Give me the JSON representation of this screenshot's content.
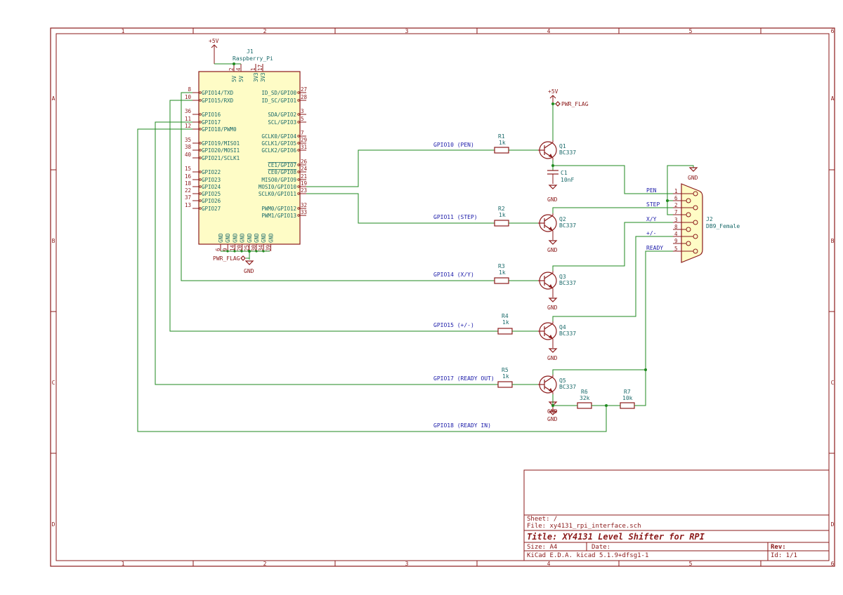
{
  "border": {
    "columns": [
      "1",
      "2",
      "3",
      "4",
      "5",
      "6"
    ],
    "rows": [
      "A",
      "B",
      "C",
      "D"
    ]
  },
  "power": {
    "vcc": "+5V",
    "gnd": "GND",
    "pwr_flag": "PWR_FLAG"
  },
  "rpi": {
    "ref": "J1",
    "value": "Raspberry_Pi",
    "left_pins": [
      {
        "num": "8",
        "name": "GPIO14/TXD"
      },
      {
        "num": "10",
        "name": "GPIO15/RXD"
      },
      {
        "num": "36",
        "name": "GPIO16"
      },
      {
        "num": "11",
        "name": "GPIO17"
      },
      {
        "num": "12",
        "name": "GPIO18/PWM0"
      },
      {
        "num": "35",
        "name": "GPIO19/MISO1"
      },
      {
        "num": "38",
        "name": "GPIO20/MOSI1"
      },
      {
        "num": "40",
        "name": "GPIO21/SCLK1"
      },
      {
        "num": "15",
        "name": "GPIO22"
      },
      {
        "num": "16",
        "name": "GPIO23"
      },
      {
        "num": "18",
        "name": "GPIO24"
      },
      {
        "num": "22",
        "name": "GPIO25"
      },
      {
        "num": "37",
        "name": "GPIO26"
      },
      {
        "num": "13",
        "name": "GPIO27"
      }
    ],
    "right_pins": [
      {
        "num": "27",
        "name": "ID_SD/GPIO0"
      },
      {
        "num": "28",
        "name": "ID_SC/GPIO1"
      },
      {
        "num": "3",
        "name": "SDA/GPIO2"
      },
      {
        "num": "5",
        "name": "SCL/GPIO3"
      },
      {
        "num": "7",
        "name": "GCLK0/GPIO4"
      },
      {
        "num": "29",
        "name": "GCLK1/GPIO5"
      },
      {
        "num": "31",
        "name": "GCLK2/GPIO6"
      },
      {
        "num": "26",
        "name": "CE1/GPIO7"
      },
      {
        "num": "24",
        "name": "CE0/GPIO8"
      },
      {
        "num": "21",
        "name": "MISO0/GPIO9"
      },
      {
        "num": "19",
        "name": "MOSI0/GPIO10"
      },
      {
        "num": "23",
        "name": "SCLK0/GPIO11"
      },
      {
        "num": "32",
        "name": "PWM0/GPIO12"
      },
      {
        "num": "33",
        "name": "PWM1/GPIO13"
      }
    ],
    "top_pins": [
      {
        "num": "2",
        "name": "5V"
      },
      {
        "num": "4",
        "name": "5V"
      },
      {
        "num": "1",
        "name": "3V3"
      },
      {
        "num": "17",
        "name": "3V3"
      }
    ],
    "bottom_pins": [
      {
        "num": "6",
        "name": "GND"
      },
      {
        "num": "9",
        "name": "GND"
      },
      {
        "num": "14",
        "name": "GND"
      },
      {
        "num": "20",
        "name": "GND"
      },
      {
        "num": "25",
        "name": "GND"
      },
      {
        "num": "30",
        "name": "GND"
      },
      {
        "num": "34",
        "name": "GND"
      },
      {
        "num": "39",
        "name": "GND"
      }
    ]
  },
  "nets": {
    "gpio10": "GPIO10 (PEN)",
    "gpio11": "GPIO11 (STEP)",
    "gpio14": "GPIO14 (X/Y)",
    "gpio15": "GPIO15 (+/-)",
    "gpio17": "GPIO17 (READY OUT)",
    "gpio18": "GPIO18 (READY IN)",
    "pen": "PEN",
    "step": "STEP",
    "xy": "X/Y",
    "pm": "+/-",
    "ready": "READY"
  },
  "resistors": [
    {
      "ref": "R1",
      "value": "1k"
    },
    {
      "ref": "R2",
      "value": "1k"
    },
    {
      "ref": "R3",
      "value": "1k"
    },
    {
      "ref": "R4",
      "value": "1k"
    },
    {
      "ref": "R5",
      "value": "1k"
    },
    {
      "ref": "R6",
      "value": "32k"
    },
    {
      "ref": "R7",
      "value": "10k"
    }
  ],
  "transistors": [
    {
      "ref": "Q1",
      "value": "BC337"
    },
    {
      "ref": "Q2",
      "value": "BC337"
    },
    {
      "ref": "Q3",
      "value": "BC337"
    },
    {
      "ref": "Q4",
      "value": "BC337"
    },
    {
      "ref": "Q5",
      "value": "BC337"
    }
  ],
  "capacitor": {
    "ref": "C1",
    "value": "10nF"
  },
  "connector": {
    "ref": "J2",
    "value": "DB9_Female",
    "pins": [
      "1",
      "6",
      "2",
      "7",
      "3",
      "8",
      "4",
      "9",
      "5"
    ]
  },
  "title_block": {
    "sheet": "Sheet: /",
    "file": "File: xy4131_rpi_interface.sch",
    "title": "Title: XY4131 Level Shifter for RPI",
    "size": "Size: A4",
    "date": "Date:",
    "rev": "Rev:",
    "tool": "KiCad E.D.A.  kicad 5.1.9+dfsg1-1",
    "id": "Id: 1/1"
  },
  "colors": {
    "frame": "#8b1a1a",
    "wire": "#1f8a1f",
    "net_label": "#1a1aa8",
    "ref_value": "#1a6a6a",
    "ic_fill": "#fefcc6"
  }
}
